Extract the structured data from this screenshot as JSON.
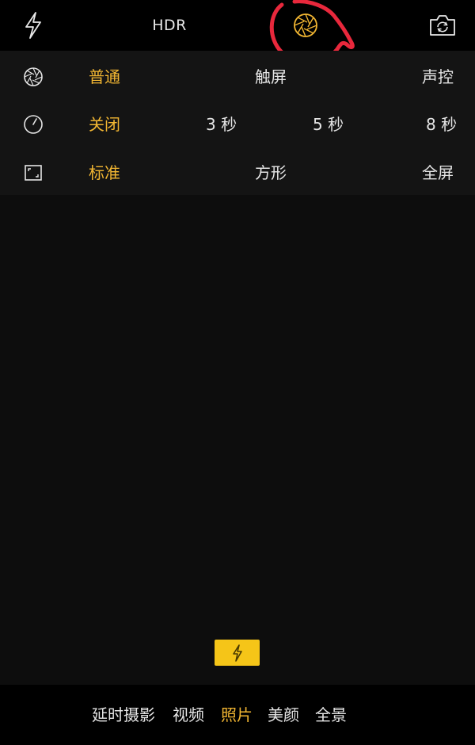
{
  "topbar": {
    "flash_icon": "flash-icon",
    "hdr_label": "HDR",
    "shutter_mode_icon": "aperture-icon",
    "switch_camera_icon": "camera-switch-icon"
  },
  "settings": {
    "rows": [
      {
        "icon": "aperture-icon",
        "options": [
          "普通",
          "触屏",
          "声控"
        ],
        "selected": 0
      },
      {
        "icon": "timer-icon",
        "options": [
          "关闭",
          "3 秒",
          "5 秒",
          "8 秒"
        ],
        "selected": 0
      },
      {
        "icon": "aspect-ratio-icon",
        "options": [
          "标准",
          "方形",
          "全屏"
        ],
        "selected": 0
      }
    ]
  },
  "flash_indicator_icon": "flash-icon",
  "modes": {
    "items": [
      "延时摄影",
      "视频",
      "照片",
      "美颜",
      "全景"
    ],
    "active": "照片"
  },
  "colors": {
    "accent": "#f2b632",
    "flash_chip": "#f5c518",
    "annotation_circle": "#e8283c",
    "panel_bg": "#141414",
    "viewfinder_bg": "#0d0d0d"
  }
}
